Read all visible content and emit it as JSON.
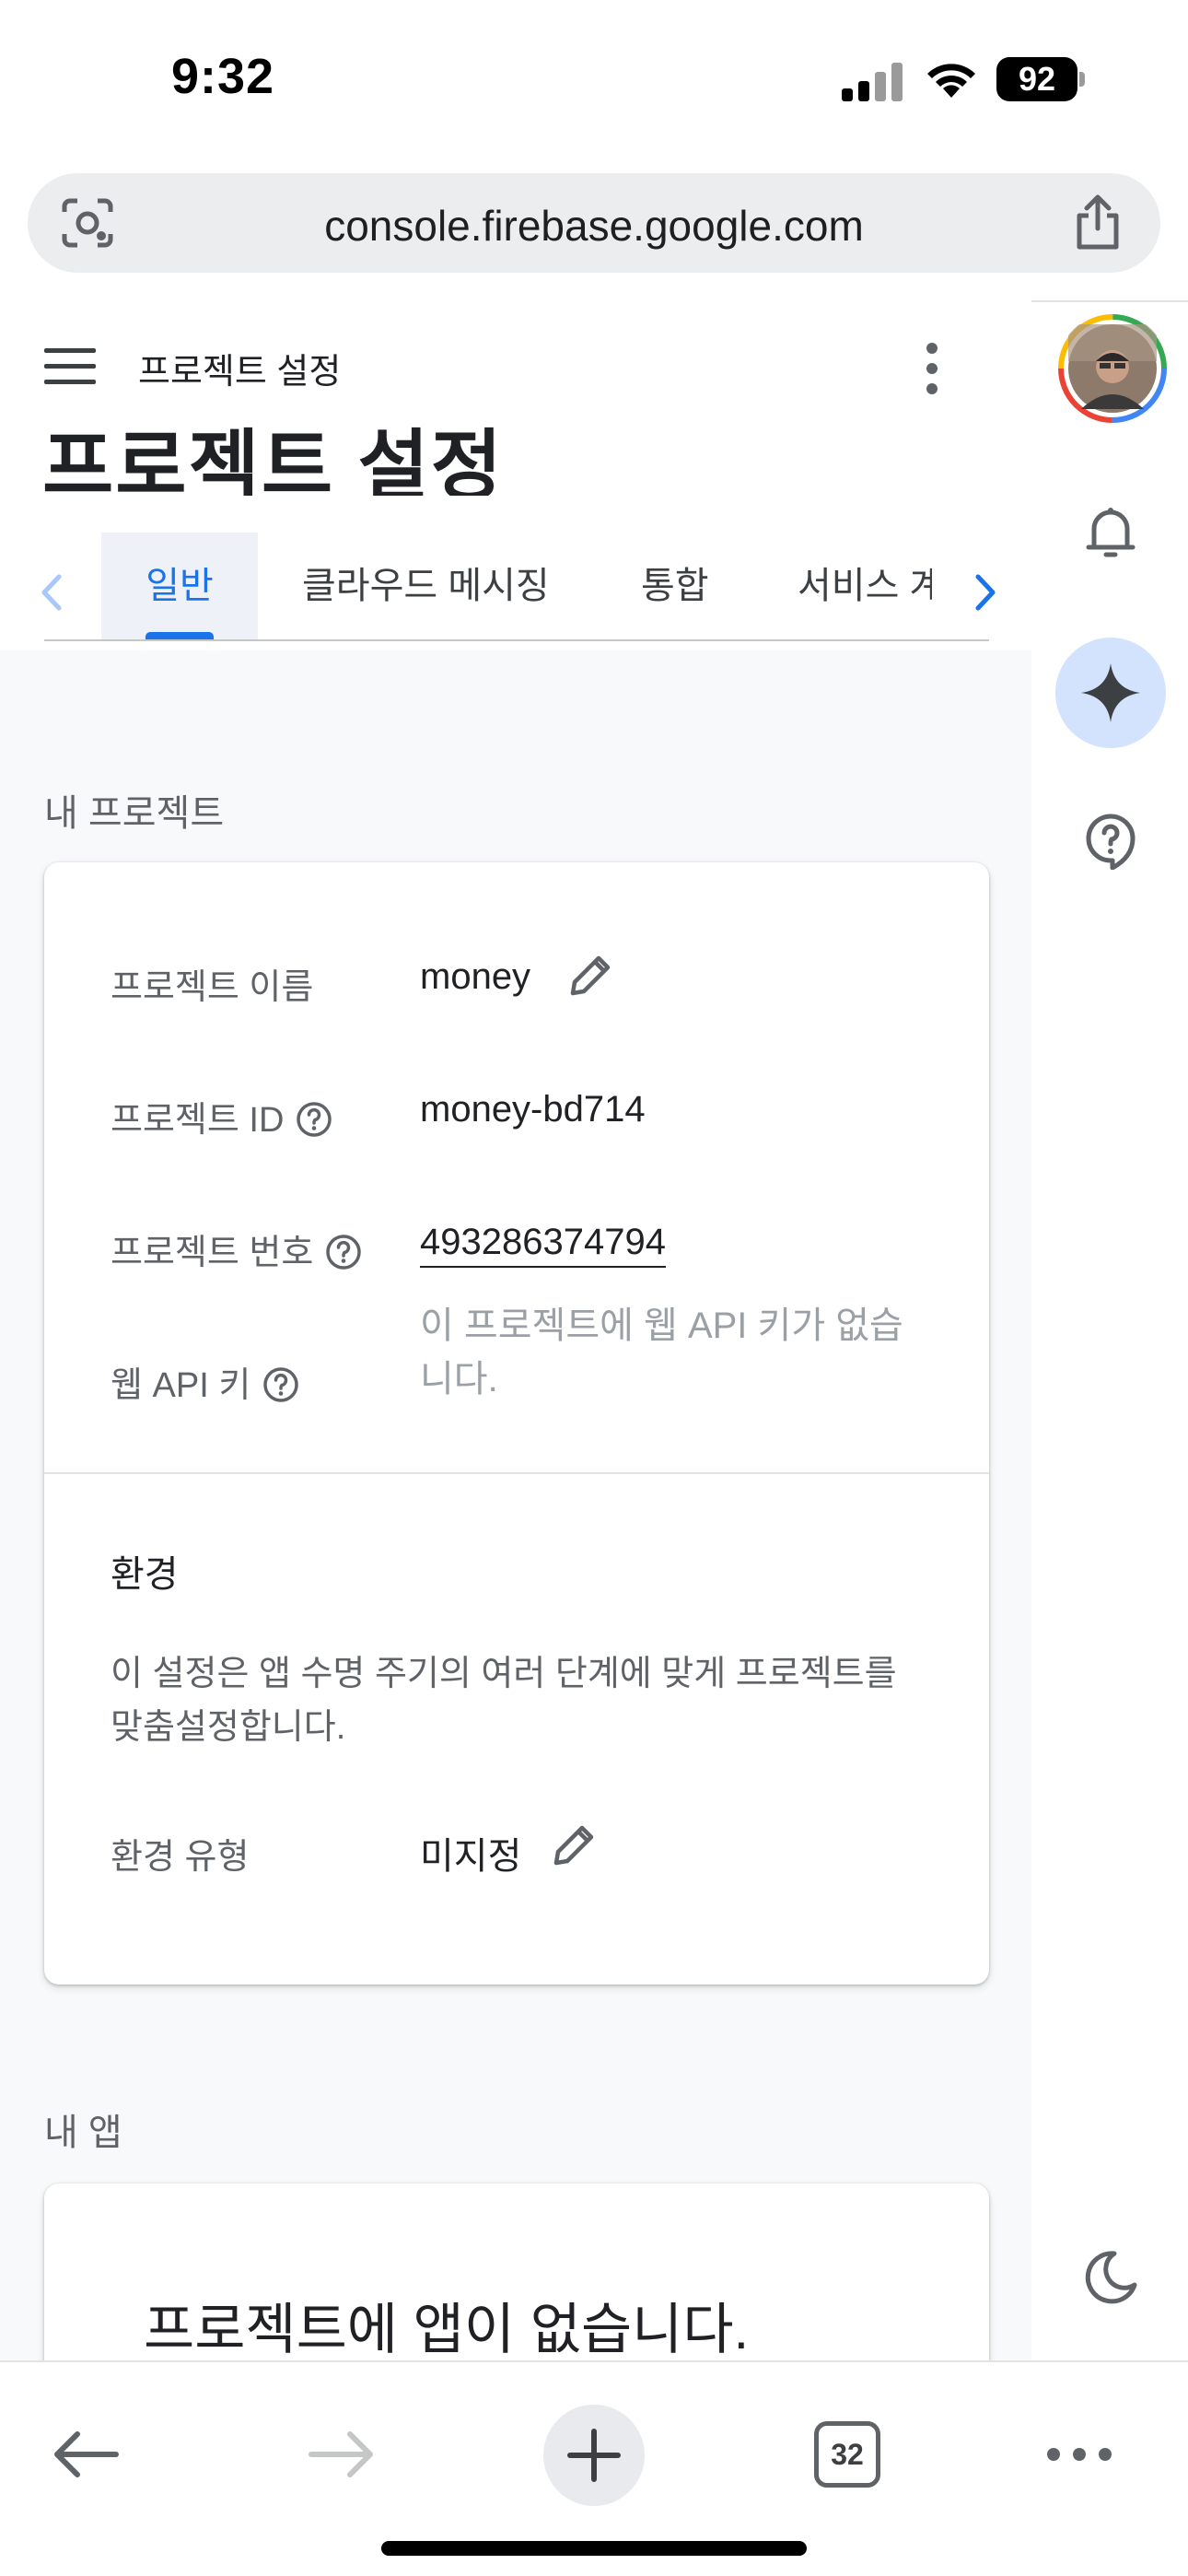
{
  "status_bar": {
    "time": "9:32",
    "battery": "92"
  },
  "browser": {
    "url": "console.firebase.google.com",
    "open_tabs": "32"
  },
  "header": {
    "breadcrumb": "프로젝트 설정",
    "title": "프로젝트 설정"
  },
  "tabs": [
    {
      "label": "일반",
      "active": true
    },
    {
      "label": "클라우드 메시징",
      "active": false
    },
    {
      "label": "통합",
      "active": false
    },
    {
      "label": "서비스 계",
      "active": false
    }
  ],
  "my_project": {
    "section_label": "내 프로젝트",
    "rows": {
      "name": {
        "label": "프로젝트 이름",
        "value": "money"
      },
      "id": {
        "label": "프로젝트 ID",
        "value": "money-bd714"
      },
      "number": {
        "label": "프로젝트 번호",
        "value": "493286374794"
      },
      "web_api_key": {
        "label": "웹 API 키",
        "value": "이 프로젝트에 웹 API 키가 없습니다."
      }
    },
    "environment": {
      "title": "환경",
      "description": "이 설정은 앱 수명 주기의 여러 단계에 맞게 프로젝트를 맞춤설정합니다.",
      "type_label": "환경 유형",
      "type_value": "미지정"
    }
  },
  "my_apps": {
    "section_label": "내 앱",
    "empty_title": "프로젝트에 앱이 없습니다."
  },
  "colors": {
    "accent": "#1a73e8",
    "gemini_bg": "#d3e3fd",
    "page_bg": "#f8f9fa"
  }
}
